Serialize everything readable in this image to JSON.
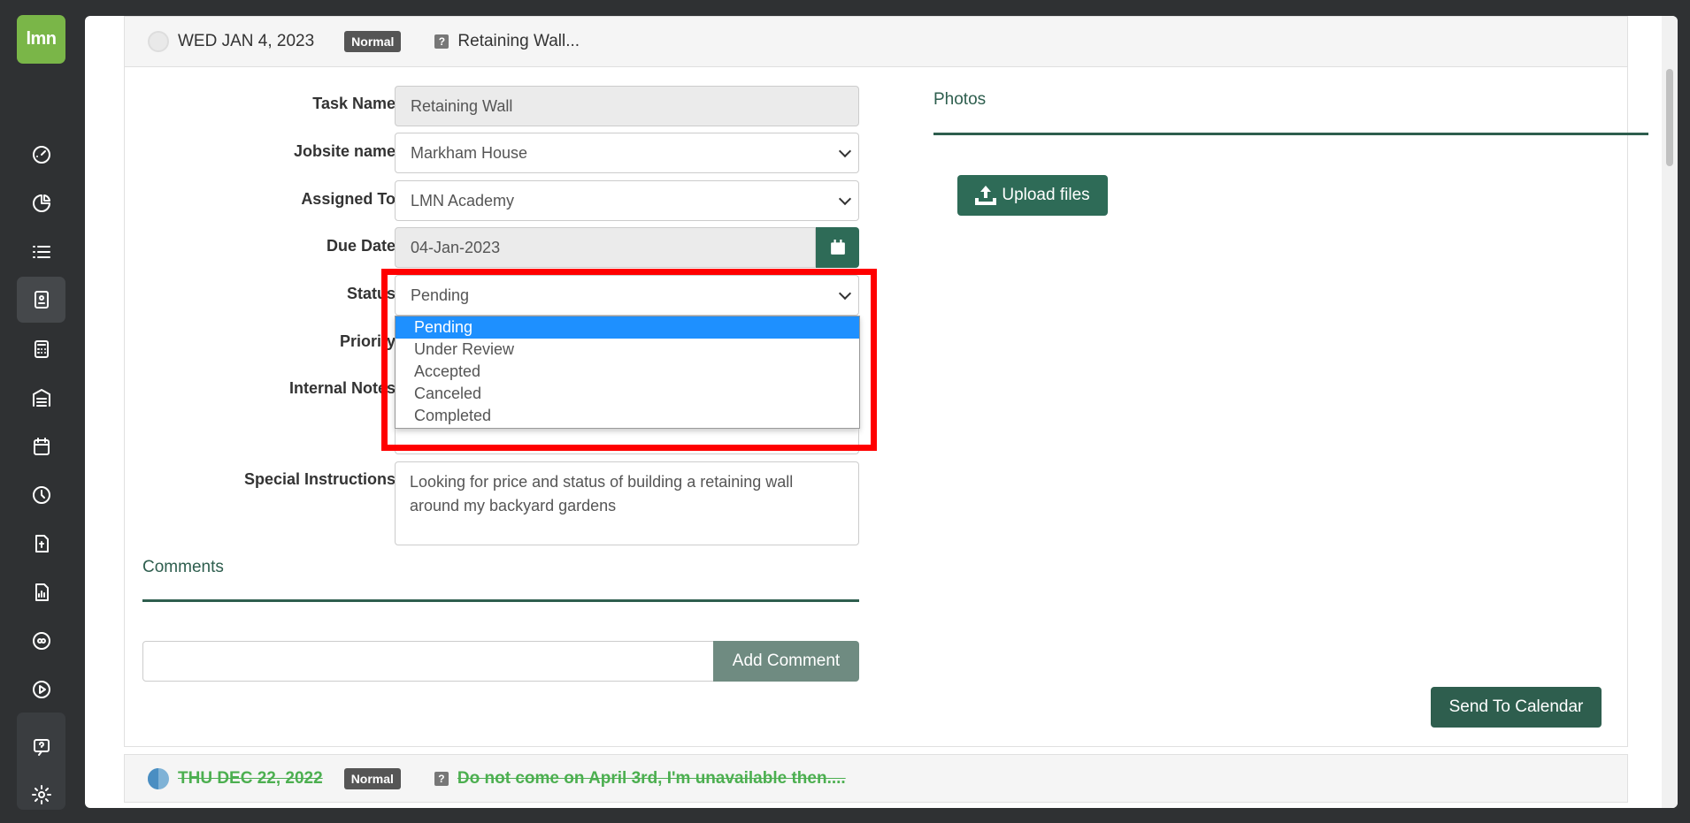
{
  "app": {
    "logo_text": "lmn"
  },
  "sidebar": {
    "items": [
      {
        "icon": "dashboard-icon"
      },
      {
        "icon": "pie-chart-icon"
      },
      {
        "icon": "list-icon"
      },
      {
        "icon": "contact-card-icon",
        "active": true
      },
      {
        "icon": "calculator-icon"
      },
      {
        "icon": "warehouse-icon"
      },
      {
        "icon": "calendar-icon"
      },
      {
        "icon": "clock-icon"
      },
      {
        "icon": "invoice-icon"
      },
      {
        "icon": "report-icon"
      },
      {
        "icon": "quickbooks-icon"
      },
      {
        "icon": "play-icon"
      },
      {
        "icon": "help-icon"
      },
      {
        "icon": "settings-icon"
      }
    ]
  },
  "task": {
    "date": "WED JAN 4, 2023",
    "priority_badge": "Normal",
    "title": "Retaining Wall..."
  },
  "form": {
    "labels": {
      "task_name": "Task Name",
      "jobsite_name": "Jobsite name",
      "assigned_to": "Assigned To",
      "due_date": "Due Date",
      "status": "Status",
      "priority": "Priority",
      "internal_notes": "Internal Notes",
      "special_instructions": "Special Instructions"
    },
    "values": {
      "task_name": "Retaining Wall",
      "jobsite_name": "Markham House",
      "assigned_to": "LMN Academy",
      "due_date": "04-Jan-2023",
      "status": "Pending",
      "special_instructions": "Looking for price and status of building a retaining wall around my backyard gardens"
    },
    "status_options": [
      "Pending",
      "Under Review",
      "Accepted",
      "Canceled",
      "Completed"
    ],
    "status_selected_index": 0
  },
  "comments": {
    "title": "Comments",
    "add_button": "Add Comment",
    "input_value": ""
  },
  "photos": {
    "title": "Photos",
    "upload_button": "Upload files"
  },
  "actions": {
    "send_to_calendar": "Send To Calendar"
  },
  "next_task": {
    "date": "THU DEC 22, 2022",
    "priority_badge": "Normal",
    "title": "Do not come on April 3rd, I'm unavailable then...."
  },
  "colors": {
    "brand_green": "#7ab648",
    "primary_dark_green": "#2e6b57",
    "section_green": "#2e5e4e",
    "highlight_red": "#ff0000",
    "selected_blue": "#1e90ff",
    "completed_green": "#4caf50"
  }
}
